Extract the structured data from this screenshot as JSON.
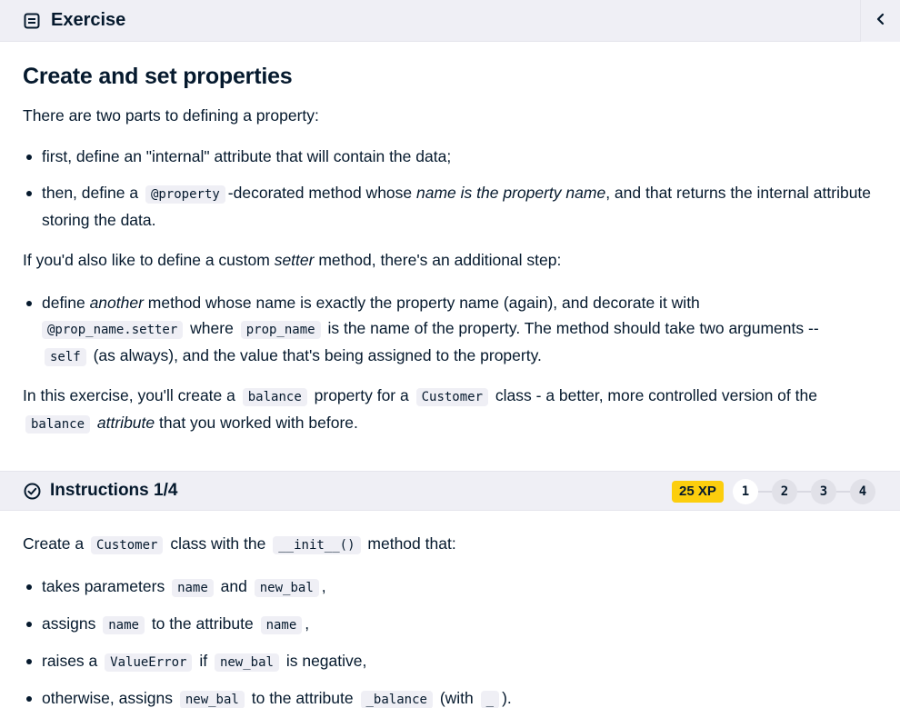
{
  "header": {
    "title": "Exercise",
    "collapse_icon": "chevron-left-icon"
  },
  "exercise": {
    "title": "Create and set properties",
    "intro": "There are two parts to defining a property:",
    "bullets": {
      "b1": "first, define an \"internal\" attribute that will contain the data;",
      "b2_a": "then, define a",
      "b2_code": "@property",
      "b2_b": "-decorated method whose",
      "b2_em": "name is the property name",
      "b2_c": ", and that returns the internal attribute storing the data."
    },
    "para2_a": "If you'd also like to define a custom",
    "para2_em": "setter",
    "para2_b": "method, there's an additional step:",
    "bullet3": {
      "a": "define",
      "em": "another",
      "b": "method whose name is exactly the property name (again), and decorate it with",
      "code1": "@prop_name.setter",
      "c": "where",
      "code2": "prop_name",
      "d": "is the name of the property. The method should take two arguments --",
      "code3": "self",
      "e": "(as always), and the value that's being assigned to the property."
    },
    "para3": {
      "a": "In this exercise, you'll create a",
      "code1": "balance",
      "b": "property for a",
      "code2": "Customer",
      "c": "class - a better, more controlled version of the",
      "code3": "balance",
      "em": "attribute",
      "d": "that you worked with before."
    }
  },
  "instructions": {
    "title": "Instructions 1/4",
    "xp": "25 XP",
    "steps": [
      "1",
      "2",
      "3",
      "4"
    ],
    "active_step": 1,
    "intro_a": "Create a",
    "intro_code1": "Customer",
    "intro_b": "class with the",
    "intro_code2": "__init__()",
    "intro_c": "method that:",
    "items": {
      "i1_a": "takes parameters",
      "i1_code1": "name",
      "i1_b": "and",
      "i1_code2": "new_bal",
      "i1_c": ",",
      "i2_a": "assigns",
      "i2_code1": "name",
      "i2_b": "to the attribute",
      "i2_code2": "name",
      "i2_c": ",",
      "i3_a": "raises a",
      "i3_code1": "ValueError",
      "i3_b": "if",
      "i3_code2": "new_bal",
      "i3_c": "is negative,",
      "i4_a": "otherwise, assigns",
      "i4_code1": "new_bal",
      "i4_b": "to the attribute",
      "i4_code2": "_balance",
      "i4_c": "(with",
      "i4_code3": "_",
      "i4_d": ")."
    }
  },
  "colors": {
    "text": "#05192d",
    "bar_bg": "#efeff5",
    "xp_badge": "#fcce0d",
    "code_bg": "#efeff5"
  }
}
